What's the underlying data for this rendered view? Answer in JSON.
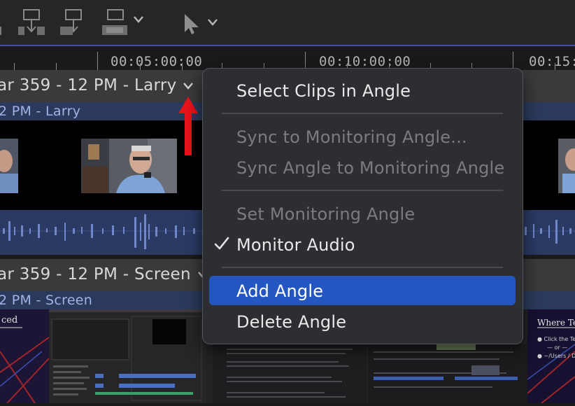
{
  "ruler": {
    "timecodes": [
      "00:05:00:00",
      "00:10:00:00",
      "00:15:"
    ]
  },
  "angles": [
    {
      "title": "ar 359 - 12 PM - Larry",
      "name": "2 PM - Larry"
    },
    {
      "title": "ar 359 - 12 PM - Screen",
      "name": "2 PM - Screen"
    }
  ],
  "thumb_texts": {
    "left_slide": "ced",
    "right_title": "Where Tem",
    "right_line1": "Click the Terra",
    "right_line2": "— or —",
    "right_line3": "~/Users / Docum"
  },
  "context_menu": {
    "items": [
      {
        "label": "Select Clips in Angle",
        "enabled": true
      },
      {
        "label": "Sync to Monitoring Angle...",
        "enabled": false
      },
      {
        "label": "Sync Angle to Monitoring Angle",
        "enabled": false
      },
      {
        "label": "Set Monitoring Angle",
        "enabled": false
      },
      {
        "label": "Monitor Audio",
        "enabled": true,
        "checked": true
      },
      {
        "label": "Add Angle",
        "enabled": true,
        "highlighted": true
      },
      {
        "label": "Delete Angle",
        "enabled": true
      }
    ]
  },
  "colors": {
    "highlight": "#2456c2",
    "angle_name_strip": "#2b3a5c",
    "audio_waveform": "#2a3a63",
    "annotation_arrow": "#e8131a"
  }
}
